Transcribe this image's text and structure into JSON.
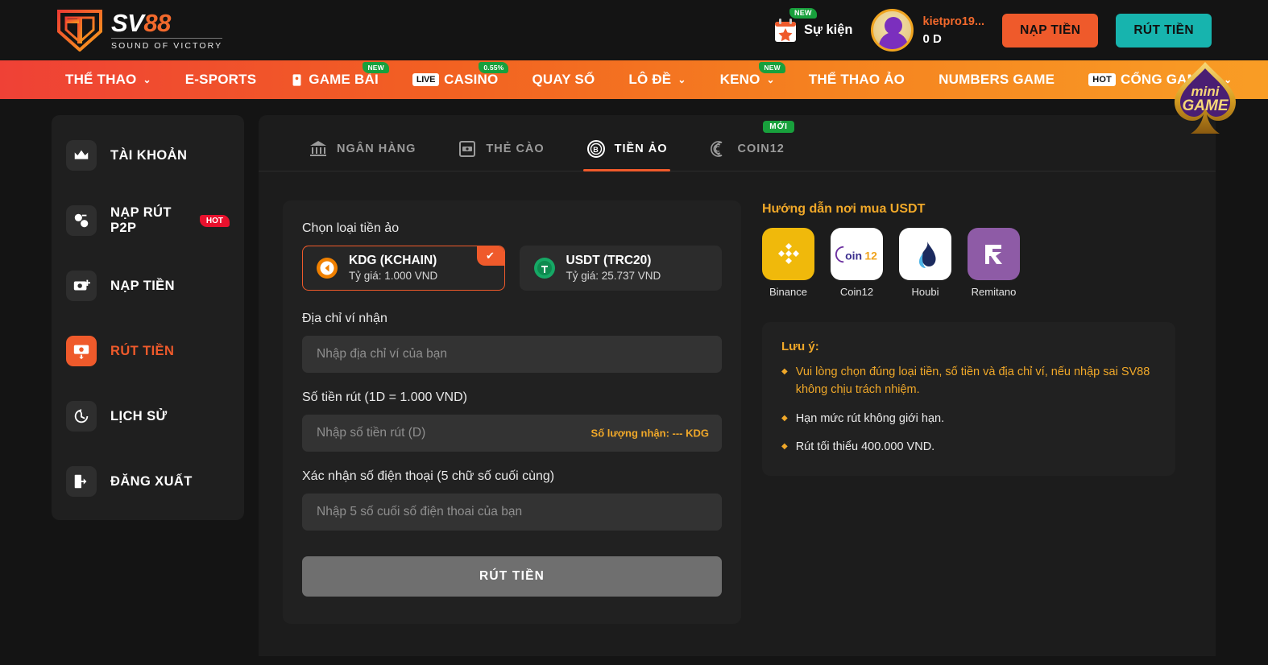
{
  "brand": {
    "logo_main_white": "SV",
    "logo_main_orange": "88",
    "logo_sub": "SOUND OF VICTORY"
  },
  "header": {
    "events_label": "Sự kiện",
    "events_badge": "NEW",
    "events_icon": "calendar-star-icon",
    "user_name": "kietpro19...",
    "user_balance": "0 D",
    "avatar_icon": "avatar",
    "deposit_label": "NẠP TIỀN",
    "withdraw_label": "RÚT TIỀN"
  },
  "nav": {
    "items": [
      {
        "label": "THỂ THAO",
        "chevron": "⌄",
        "badge": "",
        "tag": ""
      },
      {
        "label": "E-SPORTS",
        "chevron": "",
        "badge": "",
        "tag": ""
      },
      {
        "label": "GAME BÀI",
        "chevron": "",
        "badge": "NEW",
        "tag": "",
        "icon": "card-icon"
      },
      {
        "label": "CASINO",
        "chevron": "",
        "badge": "0.55%",
        "tag": "LIVE"
      },
      {
        "label": "QUAY SỐ",
        "chevron": "",
        "badge": "",
        "tag": ""
      },
      {
        "label": "LÔ ĐỀ",
        "chevron": "⌄",
        "badge": "",
        "tag": ""
      },
      {
        "label": "KENO",
        "chevron": "⌄",
        "badge": "NEW",
        "tag": ""
      },
      {
        "label": "THỂ THAO ẢO",
        "chevron": "",
        "badge": "",
        "tag": ""
      },
      {
        "label": "NUMBERS GAME",
        "chevron": "",
        "badge": "",
        "tag": ""
      },
      {
        "label": "CỔNG GAMES",
        "chevron": "⌄",
        "badge": "",
        "tag": "HOT"
      }
    ],
    "minigame_line1": "mini",
    "minigame_line2": "GAME"
  },
  "sidebar": {
    "items": [
      {
        "label": "TÀI KHOẢN",
        "icon": "crown-icon",
        "badge": "",
        "active": false
      },
      {
        "label": "NẠP RÚT P2P",
        "icon": "p2p-exchange-icon",
        "badge": "HOT",
        "active": false
      },
      {
        "label": "NẠP TIỀN",
        "icon": "money-plus-icon",
        "badge": "",
        "active": false
      },
      {
        "label": "RÚT TIỀN",
        "icon": "money-withdraw-icon",
        "badge": "",
        "active": true
      },
      {
        "label": "LỊCH SỬ",
        "icon": "history-icon",
        "badge": "",
        "active": false
      },
      {
        "label": "ĐĂNG XUẤT",
        "icon": "logout-icon",
        "badge": "",
        "active": false
      }
    ]
  },
  "tabs": [
    {
      "label": "NGÂN HÀNG",
      "icon": "bank-icon",
      "badge": "",
      "active": false
    },
    {
      "label": "THẺ CÀO",
      "icon": "scratch-card-icon",
      "badge": "",
      "active": false
    },
    {
      "label": "TIỀN ẢO",
      "icon": "bitcoin-icon",
      "badge": "",
      "active": true
    },
    {
      "label": "COIN12",
      "icon": "coin12-icon",
      "badge": "MỚI",
      "active": false
    }
  ],
  "form": {
    "coin_select_label": "Chọn loại tiền ảo",
    "coins": [
      {
        "name": "KDG (KCHAIN)",
        "rate": "Tỷ giá: 1.000 VND",
        "icon": "kdg-coin-icon",
        "selected": true,
        "check": "✔"
      },
      {
        "name": "USDT (TRC20)",
        "rate": "Tỷ giá: 25.737 VND",
        "icon": "usdt-coin-icon",
        "selected": false,
        "check": ""
      }
    ],
    "wallet_label": "Địa chỉ ví nhận",
    "wallet_placeholder": "Nhập địa chỉ ví của bạn",
    "wallet_value": "",
    "amount_label": "Số tiền rút (1D = 1.000 VND)",
    "amount_placeholder": "Nhập số tiền rút (D)",
    "amount_value": "",
    "amount_hint": "Số lượng nhận: --- KDG",
    "phone_label": "Xác nhận số điện thoại (5 chữ số cuối cùng)",
    "phone_placeholder": "Nhập 5 số cuối số điện thoai của bạn",
    "phone_value": "",
    "submit_label": "RÚT TIỀN"
  },
  "guide": {
    "title": "Hướng dẫn nơi mua USDT",
    "exchanges": [
      {
        "name": "Binance",
        "icon": "binance-logo",
        "bg": "#f0b90b"
      },
      {
        "name": "Coin12",
        "icon": "coin12-logo",
        "bg": "#ffffff"
      },
      {
        "name": "Houbi",
        "icon": "houbi-logo",
        "bg": "#ffffff"
      },
      {
        "name": "Remitano",
        "icon": "remitano-logo",
        "bg": "#8e5ba6"
      }
    ]
  },
  "notes": {
    "title": "Lưu ý:",
    "items": [
      {
        "text": "Vui lòng chọn đúng loại tiền, số tiền và địa chỉ ví, nếu nhập sai SV88 không chịu trách nhiệm.",
        "warn": true
      },
      {
        "text": "Hạn mức rút không giới hạn.",
        "warn": false
      },
      {
        "text": "Rút tối thiểu 400.000 VND.",
        "warn": false
      }
    ]
  },
  "colors": {
    "accent_orange": "#ef5a2b",
    "teal": "#17b4ae",
    "gold": "#f0a829",
    "green_badge": "#18a03c",
    "red_badge": "#e8112d",
    "page_bg": "#141414",
    "panel_bg": "#1c1c1c",
    "card_bg": "#212121"
  }
}
